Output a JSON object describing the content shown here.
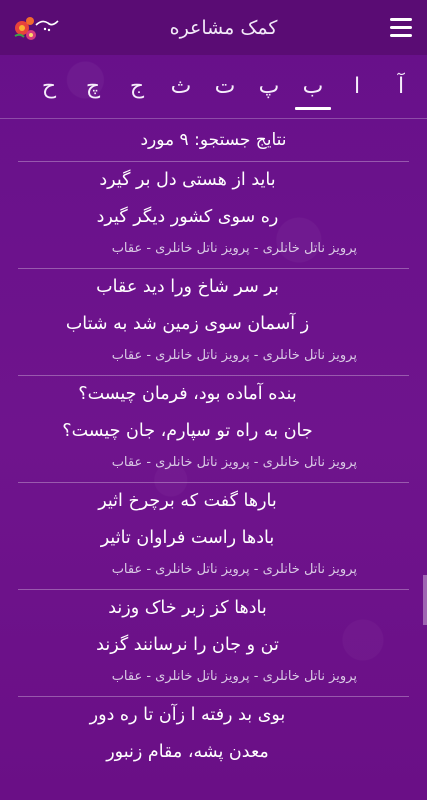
{
  "header": {
    "title": "کمک مشاعره",
    "logo_text": "بیت",
    "menu_icon": "hamburger-icon"
  },
  "alphabet": [
    "آ",
    "ا",
    "ب",
    "پ",
    "ت",
    "ث",
    "ج",
    "چ",
    "ح"
  ],
  "active_letter": "ب",
  "results": {
    "count_label": "نتایج جستجو: ۹ مورد",
    "items": [
      {
        "line1": "باید از هستی دل بر گیرد",
        "line2": "ره سوی کشور دیگر گیرد",
        "meta": "پرویز ناتل خانلری - پرویز ناتل خانلری - عقاب"
      },
      {
        "line1": "بر سر شاخ ورا دید عقاب",
        "line2": "ز آسمان سوی زمین شد به شتاب",
        "meta": "پرویز ناتل خانلری - پرویز ناتل خانلری - عقاب"
      },
      {
        "line1": "بنده آماده بود، فرمان چیست؟",
        "line2": "جان به راه تو سپارم، جان چیست؟",
        "meta": "پرویز ناتل خانلری - پرویز ناتل خانلری - عقاب"
      },
      {
        "line1": "بارها گفت که برچرخ اثیر",
        "line2": "بادها راست فراوان تاثیر",
        "meta": "پرویز ناتل خانلری - پرویز ناتل خانلری - عقاب"
      },
      {
        "line1": "بادها کز زبر خاک وزند",
        "line2": "تن و جان را نرسانند گزند",
        "meta": "پرویز ناتل خانلری - پرویز ناتل خانلری - عقاب"
      },
      {
        "line1": "بوی بد رفته ا زآن تا ره دور",
        "line2": "معدن پشه، مقام زنبور",
        "meta": ""
      }
    ]
  },
  "colors": {
    "background": "#6a0f86",
    "topbar": "#5a0c74",
    "text": "#ffffff",
    "meta_text": "#d9c9e4"
  }
}
